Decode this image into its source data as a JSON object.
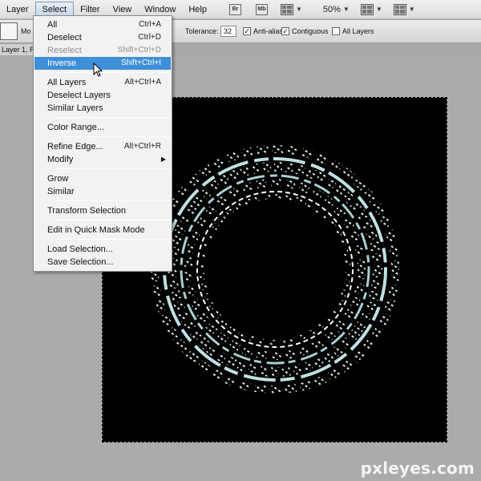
{
  "menubar": {
    "items": [
      "Layer",
      "Select",
      "Filter",
      "View",
      "Window",
      "Help"
    ],
    "active": "Select",
    "badges": [
      "Br",
      "Mb"
    ],
    "zoom": "50%"
  },
  "options": {
    "mode_label": "Mo",
    "tolerance_label": "Tolerance:",
    "tolerance_value": "32",
    "anti_alias_label": "Anti-alias",
    "contiguous_label": "Contiguous",
    "all_layers_label": "All Layers"
  },
  "document": {
    "tab_label": "Layer 1, R"
  },
  "select_menu": {
    "items": [
      {
        "label": "All",
        "shortcut": "Ctrl+A"
      },
      {
        "label": "Deselect",
        "shortcut": "Ctrl+D"
      },
      {
        "label": "Reselect",
        "shortcut": "Shift+Ctrl+D"
      },
      {
        "label": "Inverse",
        "shortcut": "Shift+Ctrl+I"
      },
      {
        "label": "All Layers",
        "shortcut": "Alt+Ctrl+A"
      },
      {
        "label": "Deselect Layers",
        "shortcut": ""
      },
      {
        "label": "Similar Layers",
        "shortcut": ""
      },
      {
        "label": "Color Range...",
        "shortcut": ""
      },
      {
        "label": "Refine Edge...",
        "shortcut": "Alt+Ctrl+R"
      },
      {
        "label": "Modify",
        "shortcut": ""
      },
      {
        "label": "Grow",
        "shortcut": ""
      },
      {
        "label": "Similar",
        "shortcut": ""
      },
      {
        "label": "Transform Selection",
        "shortcut": ""
      },
      {
        "label": "Edit in Quick Mask Mode",
        "shortcut": ""
      },
      {
        "label": "Load Selection...",
        "shortcut": ""
      },
      {
        "label": "Save Selection...",
        "shortcut": ""
      }
    ],
    "highlighted": "Inverse",
    "disabled": [
      "Reselect"
    ]
  },
  "watermark": "pxleyes.com",
  "colors": {
    "highlight": "#3f8fd8",
    "canvas": "#000000",
    "ring": "#bfe0e3",
    "workspace": "#ababab"
  }
}
